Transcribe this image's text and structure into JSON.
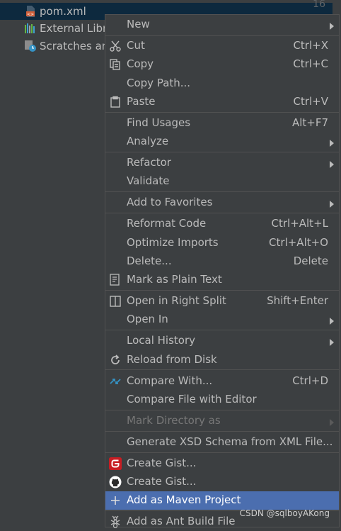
{
  "tree": {
    "line_number": "16",
    "items": [
      {
        "label": "pom.xml",
        "icon": "maven-pom-icon"
      },
      {
        "label": "External Libra",
        "icon": "libraries-icon"
      },
      {
        "label": "Scratches and",
        "icon": "scratches-icon"
      }
    ]
  },
  "menu": {
    "new": {
      "label": "New"
    },
    "cut": {
      "label": "Cut",
      "shortcut": "Ctrl+X",
      "icon": "scissors-icon"
    },
    "copy": {
      "label": "Copy",
      "shortcut": "Ctrl+C",
      "icon": "copy-icon"
    },
    "copy_path": {
      "label": "Copy Path..."
    },
    "paste": {
      "label": "Paste",
      "shortcut": "Ctrl+V",
      "icon": "clipboard-icon"
    },
    "find_usages": {
      "label": "Find Usages",
      "shortcut": "Alt+F7"
    },
    "analyze": {
      "label": "Analyze"
    },
    "refactor": {
      "label": "Refactor"
    },
    "validate": {
      "label": "Validate"
    },
    "add_to_favorites": {
      "label": "Add to Favorites"
    },
    "reformat_code": {
      "label": "Reformat Code",
      "shortcut": "Ctrl+Alt+L"
    },
    "optimize_imports": {
      "label": "Optimize Imports",
      "shortcut": "Ctrl+Alt+O"
    },
    "delete": {
      "label": "Delete...",
      "shortcut": "Delete"
    },
    "mark_plain_text": {
      "label": "Mark as Plain Text",
      "icon": "plain-text-icon"
    },
    "open_right_split": {
      "label": "Open in Right Split",
      "shortcut": "Shift+Enter",
      "icon": "split-icon"
    },
    "open_in": {
      "label": "Open In"
    },
    "local_history": {
      "label": "Local History"
    },
    "reload_from_disk": {
      "label": "Reload from Disk",
      "icon": "reload-icon"
    },
    "compare_with": {
      "label": "Compare With...",
      "shortcut": "Ctrl+D",
      "icon": "compare-icon"
    },
    "compare_file_editor": {
      "label": "Compare File with Editor"
    },
    "mark_directory": {
      "label": "Mark Directory as"
    },
    "generate_xsd": {
      "label": "Generate XSD Schema from XML File..."
    },
    "create_gist_gitee": {
      "label": "Create Gist...",
      "icon": "gitee-icon"
    },
    "create_gist_github": {
      "label": "Create Gist...",
      "icon": "github-icon"
    },
    "add_maven": {
      "label": "Add as Maven Project",
      "icon": "plus-icon"
    },
    "add_ant": {
      "label": "Add as Ant Build File",
      "icon": "ant-icon"
    }
  },
  "watermark": "CSDN @sqlboyAKong",
  "colors": {
    "background": "#3c3f41",
    "highlight": "#4b6eaf",
    "separator": "#515151",
    "text": "#bbbbbb",
    "disabled_text": "#777777"
  }
}
